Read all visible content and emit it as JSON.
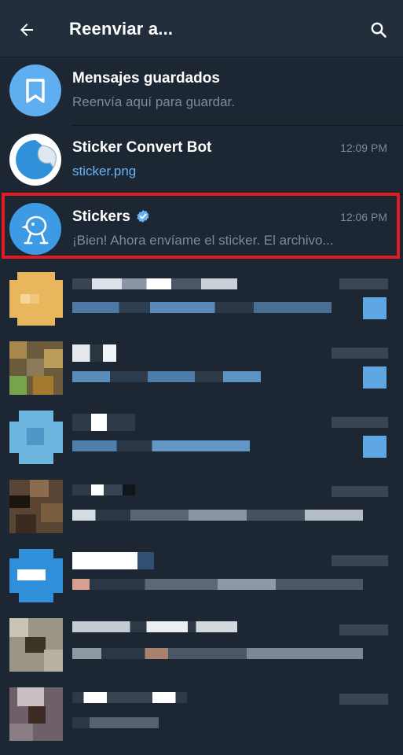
{
  "header": {
    "title": "Reenviar a...",
    "back_icon": "arrow-left-icon",
    "search_icon": "search-icon"
  },
  "chats": [
    {
      "name": "Mensajes guardados",
      "subtitle": "Reenvía aquí para guardar.",
      "time": "",
      "avatar_icon": "bookmark-icon",
      "avatar_color": "#5eaef0"
    },
    {
      "name": "Sticker Convert Bot",
      "subtitle": "sticker.png",
      "time": "12:09 PM",
      "avatar_icon": "sticker-peel-icon"
    },
    {
      "name": "Stickers",
      "subtitle": "¡Bien! Ahora envíame el sticker. El archivo...",
      "time": "12:06 PM",
      "avatar_icon": "duck-icon",
      "verified": true
    }
  ],
  "colors": {
    "background": "#1d2733",
    "header": "#232e3c",
    "highlight": "#e21b23",
    "link": "#6ab3f3",
    "secondary_text": "#7d8b99"
  }
}
